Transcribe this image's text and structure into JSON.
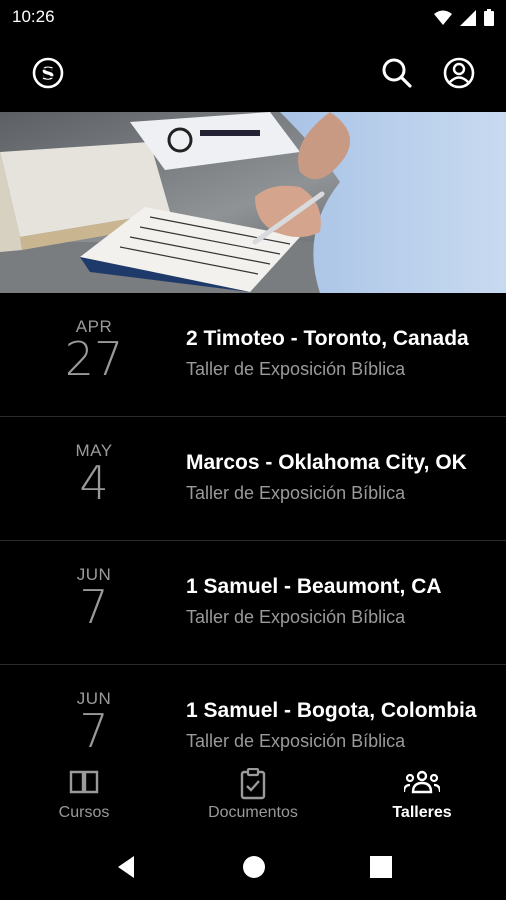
{
  "status": {
    "time": "10:26"
  },
  "appbar": {
    "logo_icon": "s-logo-icon",
    "search_icon": "search-icon",
    "account_icon": "account-icon"
  },
  "banner": {
    "image": "hand-writing-notes-photo"
  },
  "events": [
    {
      "month": "APR",
      "day": "27",
      "title": "2 Timoteo - Toronto, Canada",
      "subtitle": "Taller de Exposición Bíblica"
    },
    {
      "month": "MAY",
      "day": "4",
      "title": "Marcos - Oklahoma City, OK",
      "subtitle": "Taller de Exposición Bíblica"
    },
    {
      "month": "JUN",
      "day": "7",
      "title": "1 Samuel - Beaumont, CA",
      "subtitle": "Taller de Exposición Bíblica"
    },
    {
      "month": "JUN",
      "day": "7",
      "title": "1 Samuel - Bogota, Colombia",
      "subtitle": "Taller de Exposición Bíblica"
    }
  ],
  "bottom_nav": {
    "cursos": "Cursos",
    "documentos": "Documentos",
    "talleres": "Talleres",
    "active": "Talleres"
  },
  "colors": {
    "background": "#000000",
    "muted": "#9a9a9a",
    "divider": "#2a2a2a",
    "text": "#ffffff"
  }
}
